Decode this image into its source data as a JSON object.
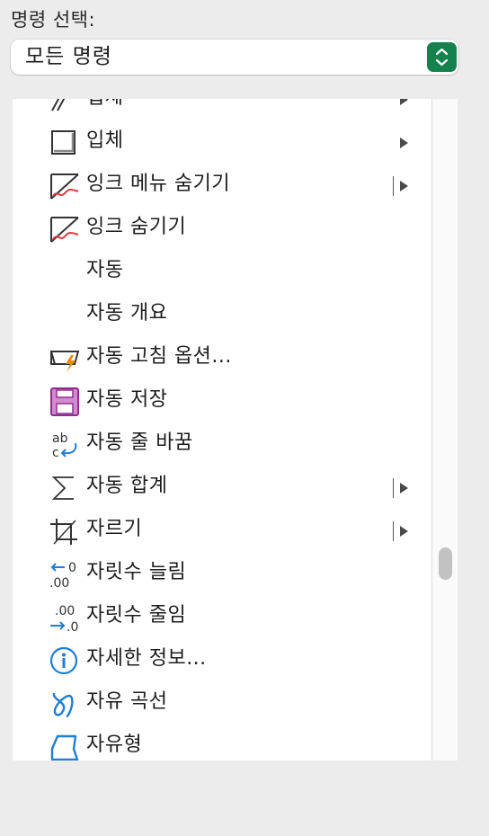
{
  "header": {
    "label": "명령 선택:"
  },
  "select": {
    "value": "모든 명령",
    "stepper_color": "#15824e"
  },
  "list": {
    "items": [
      {
        "label": "입체",
        "icon": "3d-shape-icon",
        "submenu": true,
        "separator": false
      },
      {
        "label": "입체",
        "icon": "3d-box-icon",
        "submenu": true,
        "separator": false
      },
      {
        "label": "잉크 메뉴 숨기기",
        "icon": "ink-hide-icon",
        "submenu": true,
        "separator": true
      },
      {
        "label": "잉크 숨기기",
        "icon": "ink-hide-icon",
        "submenu": false,
        "separator": false
      },
      {
        "label": "자동",
        "icon": "",
        "submenu": false,
        "separator": false
      },
      {
        "label": "자동 개요",
        "icon": "",
        "submenu": false,
        "separator": false
      },
      {
        "label": "자동 고침 옵션...",
        "icon": "autocorrect-lightning-icon",
        "submenu": false,
        "separator": false
      },
      {
        "label": "자동 저장",
        "icon": "save-disk-icon",
        "submenu": false,
        "separator": false
      },
      {
        "label": "자동 줄 바꿈",
        "icon": "wrap-text-icon",
        "submenu": false,
        "separator": false
      },
      {
        "label": "자동 합계",
        "icon": "sigma-icon",
        "submenu": true,
        "separator": true
      },
      {
        "label": "자르기",
        "icon": "crop-icon",
        "submenu": true,
        "separator": true
      },
      {
        "label": "자릿수 늘림",
        "icon": "increase-decimal-icon",
        "submenu": false,
        "separator": false
      },
      {
        "label": "자릿수 줄임",
        "icon": "decrease-decimal-icon",
        "submenu": false,
        "separator": false
      },
      {
        "label": "자세한 정보...",
        "icon": "info-icon",
        "submenu": false,
        "separator": false
      },
      {
        "label": "자유 곡선",
        "icon": "freeform-curve-icon",
        "submenu": false,
        "separator": false
      },
      {
        "label": "자유형",
        "icon": "freeform-shape-icon",
        "submenu": false,
        "separator": false
      }
    ]
  },
  "colors": {
    "ink_red": "#e03a3e",
    "save_purple": "#b24fb0",
    "blue": "#1f7ed6",
    "lightning": "#f08a00"
  }
}
